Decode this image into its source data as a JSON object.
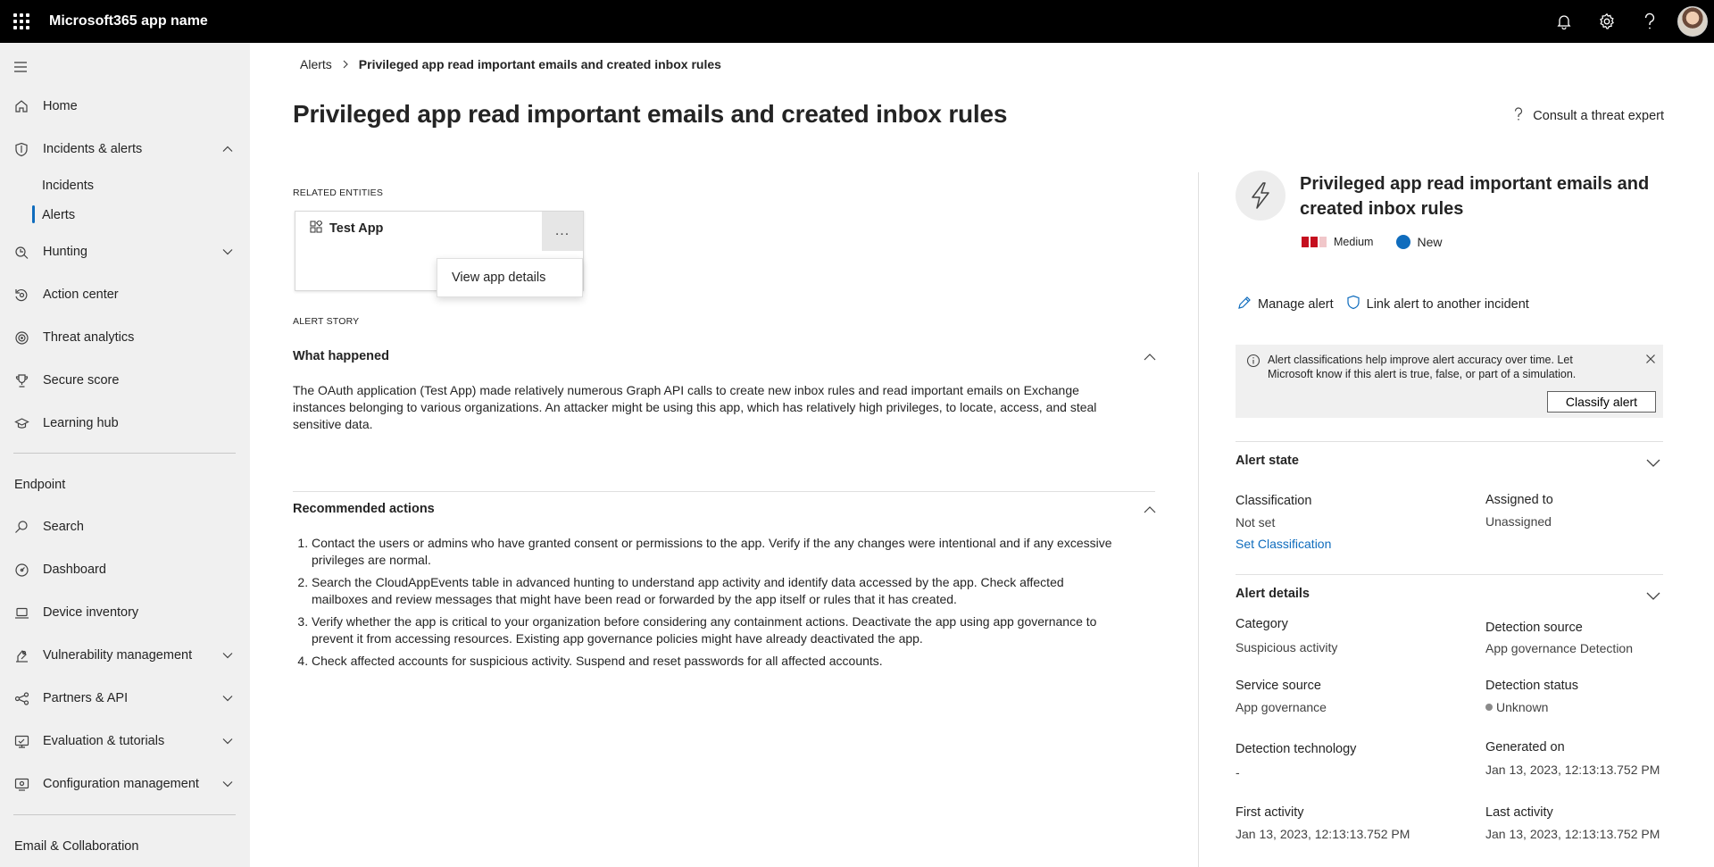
{
  "topbar": {
    "app_name": "Microsoft365 app name",
    "icons": [
      "waffle-icon",
      "bell-icon",
      "gear-icon",
      "help-icon",
      "avatar"
    ]
  },
  "sidebar": {
    "items": [
      {
        "label": "Home",
        "icon": "home-icon"
      },
      {
        "label": "Incidents & alerts",
        "icon": "shield-icon",
        "expanded": true
      },
      {
        "label": "Incidents"
      },
      {
        "label": "Alerts",
        "selected": true
      },
      {
        "label": "Hunting",
        "icon": "hunting-icon"
      },
      {
        "label": "Action center",
        "icon": "action-center-icon"
      },
      {
        "label": "Threat analytics",
        "icon": "threat-analytics-icon"
      },
      {
        "label": "Secure score",
        "icon": "trophy-icon"
      },
      {
        "label": "Learning hub",
        "icon": "learning-hub-icon"
      }
    ],
    "section_endpoint": "Endpoint",
    "endpoint_items": [
      {
        "label": "Search",
        "icon": "search-icon"
      },
      {
        "label": "Dashboard",
        "icon": "dashboard-icon"
      },
      {
        "label": "Device inventory",
        "icon": "laptop-icon"
      },
      {
        "label": "Vulnerability management",
        "icon": "vulnerability-icon"
      },
      {
        "label": "Partners & API",
        "icon": "partners-icon"
      },
      {
        "label": "Evaluation & tutorials",
        "icon": "evaluation-icon"
      },
      {
        "label": "Configuration management",
        "icon": "configuration-icon"
      }
    ],
    "section_email": "Email & Collaboration"
  },
  "breadcrumb": {
    "root": "Alerts",
    "current": "Privileged app read important emails and created inbox rules"
  },
  "page": {
    "title": "Privileged app read important emails and created inbox rules",
    "consult": "Consult a threat expert"
  },
  "entities": {
    "label": "RELATED ENTITIES",
    "app_name": "Test App",
    "more": "...",
    "menu_item": "View app details"
  },
  "story": {
    "label": "ALERT STORY",
    "what_happened_title": "What happened",
    "what_happened_text": "The OAuth application (Test App) made relatively numerous Graph API calls to create new inbox rules and read important emails on Exchange instances belonging to various organizations. An attacker might be using this app, which has relatively high privileges, to locate, access, and steal sensitive data.",
    "recommended_title": "Recommended actions",
    "recommended": [
      "Contact the users or admins who have granted consent or permissions to the app. Verify if the any changes were intentional and if any excessive privileges are normal.",
      "Search the CloudAppEvents table in advanced hunting to understand app activity and identify data accessed by the app. Check affected mailboxes and review messages that might have been read or forwarded by the app itself or rules that it has created.",
      "Verify whether the app is critical to your organization before considering any containment actions. Deactivate the app using app governance to prevent it from accessing resources. Existing app governance policies might have already deactivated the app.",
      "Check affected accounts for suspicious activity. Suspend and reset passwords for all affected accounts."
    ]
  },
  "panel": {
    "title": "Privileged app read important emails and created inbox rules",
    "severity": "Medium",
    "severity_colors": [
      "#c50f1f",
      "#c50f1f",
      "#f1c7ca"
    ],
    "status": "New",
    "manage_alert": "Manage alert",
    "link_alert": "Link alert to another incident",
    "info_text": "Alert classifications help improve alert accuracy over time. Let Microsoft know if this alert is true, false, or part of a simulation.",
    "classify_button": "Classify alert",
    "alert_state": {
      "title": "Alert state",
      "classification_label": "Classification",
      "classification_value": "Not set",
      "set_classification": "Set Classification",
      "assigned_label": "Assigned to",
      "assigned_value": "Unassigned"
    },
    "alert_details": {
      "title": "Alert details",
      "category_label": "Category",
      "category_value": "Suspicious activity",
      "detection_source_label": "Detection source",
      "detection_source_value": "App governance Detection",
      "service_source_label": "Service source",
      "service_source_value": "App governance",
      "detection_status_label": "Detection status",
      "detection_status_value": "Unknown",
      "detection_tech_label": "Detection technology",
      "detection_tech_value": "-",
      "generated_label": "Generated on",
      "generated_value": "Jan 13, 2023, 12:13:13.752 PM",
      "first_activity_label": "First activity",
      "first_activity_value": "Jan 13, 2023, 12:13:13.752 PM",
      "last_activity_label": "Last activity",
      "last_activity_value": "Jan 13, 2023, 12:13:13.752 PM"
    }
  }
}
